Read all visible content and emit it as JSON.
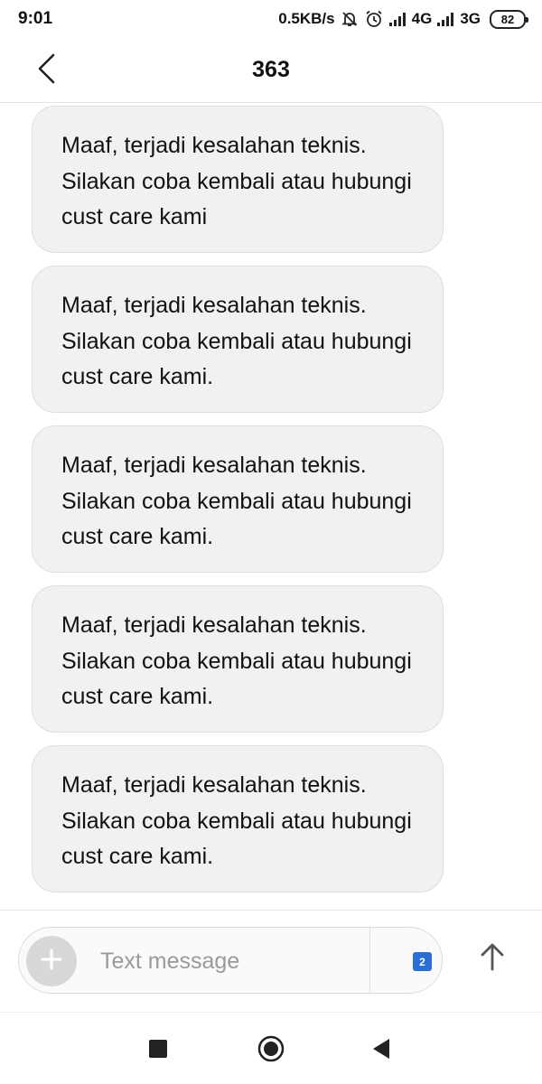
{
  "status_bar": {
    "time": "9:01",
    "network_speed": "0.5KB/s",
    "icons": [
      "mute-bell-icon",
      "alarm-icon",
      "signal-icon",
      "signal-icon"
    ],
    "network_1": "4G",
    "network_2": "3G",
    "battery": "82"
  },
  "header": {
    "title": "363",
    "back_icon": "chevron-left-icon"
  },
  "messages": [
    {
      "text": "Maaf, terjadi kesalahan teknis. Silakan coba kembali atau hubungi cust care kami"
    },
    {
      "text": "Maaf, terjadi kesalahan teknis. Silakan coba kembali atau hubungi cust care kami."
    },
    {
      "text": "Maaf, terjadi kesalahan teknis. Silakan coba kembali atau hubungi cust care kami."
    },
    {
      "text": "Maaf, terjadi kesalahan teknis. Silakan coba kembali atau hubungi cust care kami."
    },
    {
      "text": "Maaf, terjadi kesalahan teknis. Silakan coba kembali atau hubungi cust care kami."
    }
  ],
  "composer": {
    "placeholder": "Text message",
    "value": "",
    "sim_label": "2",
    "add_icon": "plus-icon",
    "send_icon": "arrow-up-icon"
  },
  "nav_bar": {
    "icons": [
      "recents-square-icon",
      "home-circle-icon",
      "back-triangle-icon"
    ]
  },
  "colors": {
    "bubble_background": "#f1f1f1",
    "sim_badge": "#2a6fd6",
    "placeholder": "#9a9a9a"
  }
}
